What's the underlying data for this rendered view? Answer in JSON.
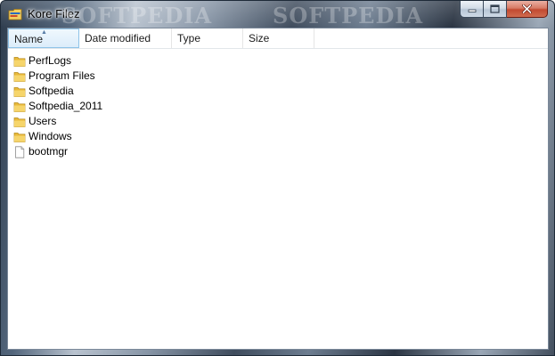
{
  "window": {
    "title": "Kore Filez",
    "watermarks": [
      "SOFTPEDIA",
      "SOFTPEDIA"
    ]
  },
  "colors": {
    "selected_header_bg": "#dcecfa",
    "selected_header_border": "#8ec3e8",
    "close_button": "#c24a31",
    "folder_yellow": "#e8b93a"
  },
  "columns": [
    {
      "label": "Name",
      "sorted": "ascending"
    },
    {
      "label": "Date modified"
    },
    {
      "label": "Type"
    },
    {
      "label": "Size"
    }
  ],
  "files": [
    {
      "name": "PerfLogs",
      "icon": "folder-icon"
    },
    {
      "name": "Program Files",
      "icon": "folder-icon"
    },
    {
      "name": "Softpedia",
      "icon": "folder-icon"
    },
    {
      "name": "Softpedia_2011",
      "icon": "folder-icon"
    },
    {
      "name": "Users",
      "icon": "folder-icon"
    },
    {
      "name": "Windows",
      "icon": "folder-icon"
    },
    {
      "name": "bootmgr",
      "icon": "file-icon"
    }
  ]
}
